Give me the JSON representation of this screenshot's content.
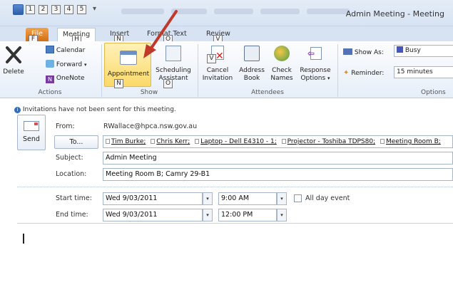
{
  "window": {
    "title": "Admin Meeting - Meeting"
  },
  "qat": {
    "keytips": [
      "1",
      "2",
      "3",
      "4",
      "5"
    ]
  },
  "tabs": [
    {
      "label": "File",
      "keytip": "F"
    },
    {
      "label": "Meeting",
      "keytip": "H"
    },
    {
      "label": "Insert",
      "keytip": "N"
    },
    {
      "label": "Format Text",
      "keytip": "O"
    },
    {
      "label": "Review",
      "keytip": "V"
    }
  ],
  "ribbon": {
    "actions": {
      "group_label": "Actions",
      "delete": "Delete",
      "calendar": "Calendar",
      "forward": "Forward",
      "onenote": "OneNote"
    },
    "show": {
      "group_label": "Show",
      "appointment": "Appointment",
      "scheduling": [
        "Scheduling",
        "Assistant"
      ]
    },
    "attendees": {
      "group_label": "Attendees",
      "cancel": [
        "Cancel",
        "Invitation"
      ],
      "address_book": [
        "Address",
        "Book"
      ],
      "check_names": [
        "Check",
        "Names"
      ],
      "response_options": [
        "Response",
        "Options"
      ]
    },
    "options": {
      "group_label": "Options",
      "show_as_label": "Show As:",
      "show_as_value": "Busy",
      "reminder_label": "Reminder:",
      "reminder_value": "15 minutes"
    }
  },
  "form": {
    "info": "Invitations have not been sent for this meeting.",
    "send": "Send",
    "from_label": "From:",
    "from_value": "RWallace@hpca.nsw.gov.au",
    "to_button": "To...",
    "recipients": [
      "Tim Burke;",
      "Chris Kerr;",
      "Laptop - Dell E4310 - 1;",
      "Projector - Toshiba TDPS80;",
      "Meeting Room B;"
    ],
    "subject_label": "Subject:",
    "subject_value": "Admin Meeting",
    "location_label": "Location:",
    "location_value": "Meeting Room B; Camry 29-B1",
    "start_label": "Start time:",
    "start_date": "Wed 9/03/2011",
    "start_time": "9:00 AM",
    "end_label": "End time:",
    "end_date": "Wed 9/03/2011",
    "end_time": "12:00 PM",
    "all_day_label": "All day event"
  },
  "colors": {
    "ribbon_bg": "#e6eef8",
    "file_tab": "#e07b1f",
    "appointment_highlight": "#fbe28a",
    "annotation_arrow": "#c0392b"
  }
}
